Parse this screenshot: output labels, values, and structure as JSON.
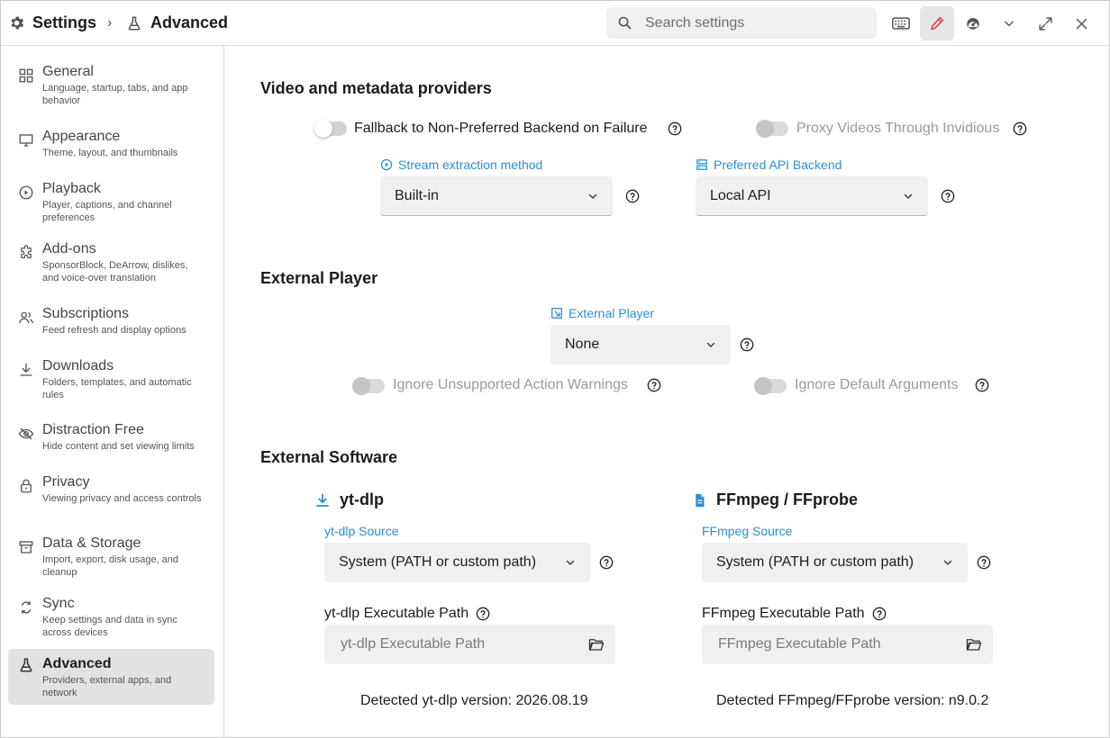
{
  "header": {
    "settings_label": "Settings",
    "breadcrumb_separator": "›",
    "page_label": "Advanced",
    "search_placeholder": "Search settings"
  },
  "toolbar": {
    "icons": [
      "keyboard-icon",
      "pen-icon",
      "speedometer-icon",
      "chevron-down-icon",
      "expand-icon",
      "close-icon"
    ],
    "active_icon": "pen-icon",
    "accent_color": "#e53935"
  },
  "sidebar": {
    "items": [
      {
        "icon": "grid-icon",
        "title": "General",
        "desc": "Language, startup, tabs, and app behavior"
      },
      {
        "icon": "monitor-icon",
        "title": "Appearance",
        "desc": "Theme, layout, and thumbnails"
      },
      {
        "icon": "play-circle-icon",
        "title": "Playback",
        "desc": "Player, captions, and channel preferences"
      },
      {
        "icon": "puzzle-icon",
        "title": "Add-ons",
        "desc": "SponsorBlock, DeArrow, dislikes, and voice-over translation"
      },
      {
        "icon": "people-icon",
        "title": "Subscriptions",
        "desc": "Feed refresh and display options"
      },
      {
        "icon": "download-icon",
        "title": "Downloads",
        "desc": "Folders, templates, and automatic rules"
      },
      {
        "icon": "eye-off-icon",
        "title": "Distraction Free",
        "desc": "Hide content and set viewing limits"
      },
      {
        "icon": "lock-icon",
        "title": "Privacy",
        "desc": "Viewing privacy and access controls"
      },
      {
        "icon": "archive-icon",
        "title": "Data & Storage",
        "desc": "Import, export, disk usage, and cleanup"
      },
      {
        "icon": "sync-icon",
        "title": "Sync",
        "desc": "Keep settings and data in sync across devices"
      },
      {
        "icon": "flask-icon",
        "title": "Advanced",
        "desc": "Providers, external apps, and network",
        "active": true
      }
    ]
  },
  "video_section": {
    "title": "Video and metadata providers",
    "fallback_toggle": {
      "label": "Fallback to Non-Preferred Backend on Failure",
      "on": false,
      "enabled": true
    },
    "proxy_toggle": {
      "label": "Proxy Videos Through Invidious",
      "on": false,
      "enabled": false
    },
    "stream_method": {
      "label": "Stream extraction method",
      "value": "Built-in"
    },
    "api_backend": {
      "label": "Preferred API Backend",
      "value": "Local API"
    }
  },
  "external_player_section": {
    "title": "External Player",
    "player": {
      "label": "External Player",
      "value": "None"
    },
    "ignore_warnings_toggle": {
      "label": "Ignore Unsupported Action Warnings",
      "on": false,
      "enabled": false
    },
    "ignore_default_args_toggle": {
      "label": "Ignore Default Arguments",
      "on": false,
      "enabled": false
    }
  },
  "external_software_section": {
    "title": "External Software",
    "ytdlp": {
      "title": "yt-dlp",
      "source_label": "yt-dlp Source",
      "source_value": "System (PATH or custom path)",
      "path_label": "yt-dlp Executable Path",
      "path_placeholder": "yt-dlp Executable Path",
      "version_text": "Detected yt-dlp version: 2026.08.19"
    },
    "ffmpeg": {
      "title": "FFmpeg / FFprobe",
      "source_label": "FFmpeg Source",
      "source_value": "System (PATH or custom path)",
      "path_label": "FFmpeg Executable Path",
      "path_placeholder": "FFmpeg Executable Path",
      "version_text": "Detected FFmpeg/FFprobe version: n9.0.2"
    }
  },
  "colors": {
    "accent_blue": "#2d8fd0",
    "active_nav_bg": "#e2e2e2",
    "field_bg": "#f0f0f0"
  }
}
